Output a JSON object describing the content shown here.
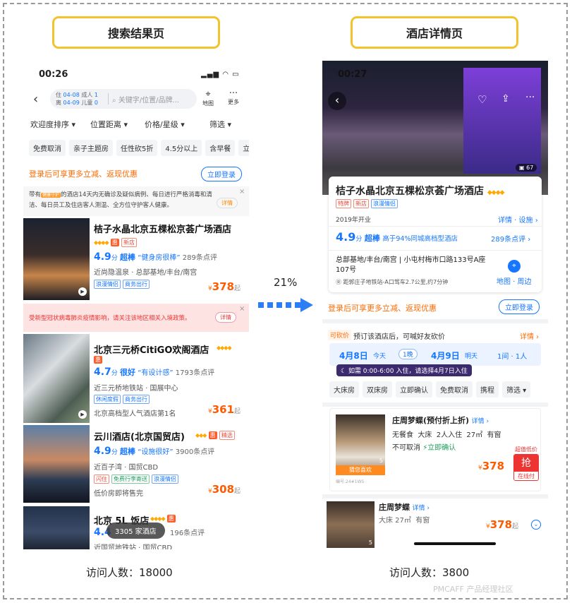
{
  "titles": {
    "left": "搜索结果页",
    "right": "酒店详情页"
  },
  "captions": {
    "left": "访问人数：18000",
    "right": "访问人数：3800"
  },
  "conversion": "21%",
  "watermark": "PMCAFF 产品经理社区",
  "left": {
    "time": "00:26",
    "dates": {
      "in_label": "住",
      "in": "04-08",
      "out_label": "离",
      "out": "04-09",
      "adult_label": "成人",
      "adult": "1",
      "child_label": "儿童",
      "child": "0"
    },
    "search_placeholder": "关键字/位置/品牌...",
    "map_label": "地图",
    "more_label": "更多",
    "sorts": [
      "欢迎度排序",
      "位置距离",
      "价格/星级",
      "筛选"
    ],
    "filters": [
      "免费取消",
      "亲子主题房",
      "任性砍5折",
      "4.5分以上",
      "含早餐",
      "立"
    ],
    "login_text": "登录后可享更多立减、返现优惠",
    "login_btn": "立即登录",
    "notice": {
      "p1": "带有",
      "badge": "健康守护",
      "p2": "的酒店14天内无确诊及疑似病例、每日进行严格消毒和清洁、每日员工及住店客人测温、全方位守护客人健康。",
      "detail": "详情",
      "close": "×"
    },
    "covid": {
      "text": "受新型冠状病毒肺炎疫情影响，请关注该地区相关入境政策。",
      "btn": "详情",
      "close": "×"
    },
    "hotels": [
      {
        "name": "桔子水晶北京五棵松京荟广场酒店",
        "diamonds": "◆◆◆◆",
        "newtag": "新店",
        "score": "4.9",
        "unit": "分",
        "level": "超棒",
        "quote": "“健身房很棒”",
        "reviews": "289条点评",
        "loc": "近尚隐温泉 · 总部基地/丰台/南宫",
        "tags": [
          "浪漫情侣",
          "商务出行"
        ],
        "red": "",
        "price": "378"
      },
      {
        "name": "北京三元桥CitiGO欢阁酒店",
        "diamonds": "◆◆◆◆",
        "newtag": "",
        "score": "4.7",
        "unit": "分",
        "level": "很好",
        "quote": "“有设计感”",
        "reviews": "1793条点评",
        "loc": "近三元桥地铁站 · 国展中心",
        "tags": [
          "休闲度假",
          "商务出行"
        ],
        "red": "北京高档型人气酒店第1名",
        "price": "361"
      },
      {
        "name": "云川酒店(北京国贸店)",
        "diamonds": "◆◆◆",
        "newtag": "",
        "jing": "精选",
        "score": "4.9",
        "unit": "分",
        "level": "超棒",
        "quote": "“设施很好”",
        "reviews": "3900条点评",
        "loc": "近百子湾 · 国贸CBD",
        "tags": [
          "闪住",
          "免费行李寄送",
          "浪漫情侣"
        ],
        "red": "低价房即将售完",
        "price": "308"
      },
      {
        "name": "北京 5L 饭店",
        "diamonds": "◆◆◆◆",
        "score": "4.4",
        "reviews": "196条点评",
        "loc": "近国贸地铁站 · 国贸CBD"
      }
    ],
    "price_unit": "起",
    "currency": "¥",
    "count_badge": "3305 家酒店"
  },
  "right": {
    "time": "00:27",
    "photo_count": "67",
    "hotel_name": "桔子水晶北京五棵松京荟广场酒店",
    "diamonds": "◆◆◆◆",
    "badges": [
      "特牌",
      "新店",
      "浪漫情侣"
    ],
    "opened": "2019年开业",
    "facilities": "详情 · 设施",
    "score": "4.9",
    "unit": "分",
    "level": "超棒",
    "compare": "高于94%同城高档型酒店",
    "reviews": "289条点评",
    "address1": "总部基地/丰台/南宫",
    "address2": "小屯村梅市口路133号A座107号",
    "distance": "距郭庄子地铁站-A口驾车2.7公里,约7分钟",
    "map_label": "地图 · 周边",
    "login_text": "登录后可享更多立减、返现优惠",
    "login_btn": "立即登录",
    "bargain": {
      "tag": "可砍价",
      "text": "预订该酒店后，可喊好友砍价",
      "link": "详情"
    },
    "checkin": {
      "date": "4月8日",
      "day": "今天",
      "nights": "1晚",
      "out_date": "4月9日",
      "out_day": "明天",
      "rooms": "1间 · 1人"
    },
    "tip": "如需 0:00-6:00 入住，请选择4月7日入住",
    "room_filters": [
      "大床房",
      "双床房",
      "立即确认",
      "免费取消",
      "携程",
      "筛选"
    ],
    "room1": {
      "name": "庄周梦蝶(预付折上折)",
      "detail": "详情",
      "info": "无餐食  大床  2人入住  27㎡  有窗",
      "cancel": "不可取消",
      "confirm": "立即确认",
      "deal": "超值低价",
      "grab": "抢",
      "pay": "在线付",
      "price": "378",
      "guess": "猜您喜欢",
      "id": "编号:24#1WS",
      "count": "5"
    },
    "room2": {
      "name": "庄周梦蝶",
      "detail": "详情",
      "info": "大床 27㎡  有窗",
      "price": "378",
      "unit": "起",
      "count": "5"
    }
  }
}
